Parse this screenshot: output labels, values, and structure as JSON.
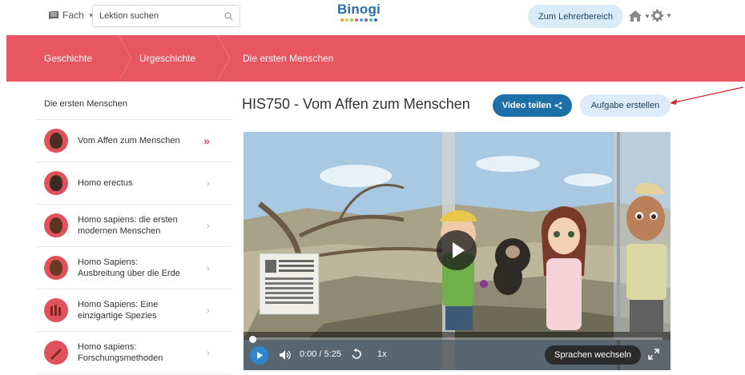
{
  "header": {
    "subject_label": "Fach",
    "search_placeholder": "Lektion suchen",
    "logo_text": "Binogi",
    "teacher_button": "Zum Lehrerbereich"
  },
  "breadcrumb": {
    "items": [
      "Geschichte",
      "Urgeschichte",
      "Die ersten Menschen"
    ]
  },
  "sidebar": {
    "title": "Die ersten Menschen",
    "lessons": [
      {
        "label": "Vom Affen zum Menschen",
        "active": true
      },
      {
        "label": "Homo erectus",
        "active": false
      },
      {
        "label": "Homo sapiens: die ersten modernen Menschen",
        "active": false
      },
      {
        "label": "Homo Sapiens: Ausbreitung über die Erde",
        "active": false
      },
      {
        "label": "Homo Sapiens: Eine einzigartige Spezies",
        "active": false
      },
      {
        "label": "Homo sapiens: Forschungsmethoden",
        "active": false
      }
    ]
  },
  "main": {
    "title": "HIS750 - Vom Affen zum Menschen",
    "share_button": "Video teilen",
    "task_button": "Aufgabe erstellen"
  },
  "video": {
    "time": "0:00 / 5:25",
    "speed": "1x",
    "language_button": "Sprachen wechseln",
    "progress": 0.0
  },
  "colors": {
    "brand_red": "#e85761",
    "brand_blue": "#1d6fa8",
    "light_blue": "#dcebf7",
    "logo_blue": "#2c6bb3"
  }
}
